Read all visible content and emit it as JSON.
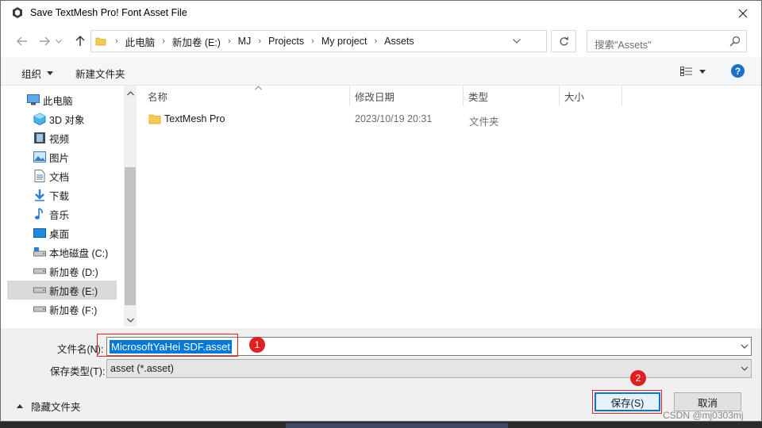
{
  "window": {
    "title": "Save TextMesh Pro! Font Asset File"
  },
  "address": {
    "crumbs": [
      "此电脑",
      "新加卷 (E:)",
      "MJ",
      "Projects",
      "My project",
      "Assets"
    ]
  },
  "search": {
    "placeholder": "搜索\"Assets\""
  },
  "toolbar": {
    "organize": "组织",
    "new_folder": "新建文件夹",
    "help": "?"
  },
  "sidebar": {
    "items": [
      {
        "label": "此电脑",
        "icon": "computer-icon"
      },
      {
        "label": "3D 对象",
        "icon": "cube-icon"
      },
      {
        "label": "视频",
        "icon": "video-icon"
      },
      {
        "label": "图片",
        "icon": "picture-icon"
      },
      {
        "label": "文档",
        "icon": "document-icon"
      },
      {
        "label": "下载",
        "icon": "download-icon"
      },
      {
        "label": "音乐",
        "icon": "music-icon"
      },
      {
        "label": "桌面",
        "icon": "desktop-icon"
      },
      {
        "label": "本地磁盘 (C:)",
        "icon": "drive-icon"
      },
      {
        "label": "新加卷 (D:)",
        "icon": "drive-icon"
      },
      {
        "label": "新加卷 (E:)",
        "icon": "drive-icon",
        "selected": true
      },
      {
        "label": "新加卷 (F:)",
        "icon": "drive-icon"
      }
    ]
  },
  "filelist": {
    "columns": [
      "名称",
      "修改日期",
      "类型",
      "大小"
    ],
    "rows": [
      {
        "name": "TextMesh Pro",
        "modified": "2023/10/19 20:31",
        "type": "文件夹",
        "size": ""
      }
    ]
  },
  "form": {
    "filename_label": "文件名(N):",
    "filename_value": "MicrosoftYaHei SDF.asset",
    "type_label": "保存类型(T):",
    "type_value": "asset (*.asset)"
  },
  "footer": {
    "hide_folders": "隐藏文件夹",
    "save": "保存(S)",
    "cancel": "取消"
  },
  "annotations": {
    "badge1": "1",
    "badge2": "2"
  },
  "watermark": "CSDN @mj0303mj",
  "colors": {
    "accent": "#0078d7",
    "annotation": "#e02020",
    "folder": "#f6c94f"
  }
}
